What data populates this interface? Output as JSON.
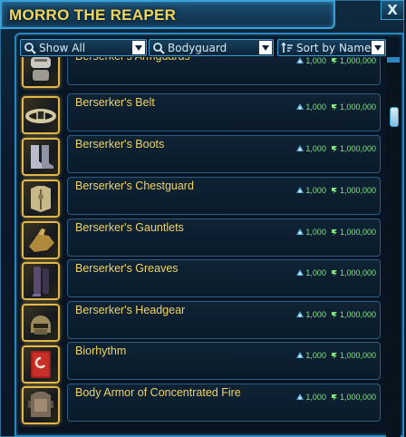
{
  "window": {
    "title": "MORRO THE REAPER",
    "close_label": "X"
  },
  "filters": {
    "category": "Show All",
    "subcategory": "Bodyguard",
    "sort": "Sort by Name"
  },
  "colors": {
    "title": "#f0d65a",
    "item_name": "#f0d462",
    "price": "#7fe37f",
    "accent": "#3aa0d8",
    "icon_border": "#e3b64a"
  },
  "items": [
    {
      "name": "Berserker's Armguards",
      "icon": "armguards-icon",
      "cost_a": "1,000",
      "cost_b": "1,000,000"
    },
    {
      "name": "Berserker's Belt",
      "icon": "belt-icon",
      "cost_a": "1,000",
      "cost_b": "1,000,000"
    },
    {
      "name": "Berserker's Boots",
      "icon": "boots-icon",
      "cost_a": "1,000",
      "cost_b": "1,000,000"
    },
    {
      "name": "Berserker's Chestguard",
      "icon": "chestguard-icon",
      "cost_a": "1,000",
      "cost_b": "1,000,000"
    },
    {
      "name": "Berserker's Gauntlets",
      "icon": "gauntlets-icon",
      "cost_a": "1,000",
      "cost_b": "1,000,000"
    },
    {
      "name": "Berserker's Greaves",
      "icon": "greaves-icon",
      "cost_a": "1,000",
      "cost_b": "1,000,000"
    },
    {
      "name": "Berserker's Headgear",
      "icon": "headgear-icon",
      "cost_a": "1,000",
      "cost_b": "1,000,000"
    },
    {
      "name": "Biorhythm",
      "icon": "biorhythm-book-icon",
      "cost_a": "1,000",
      "cost_b": "1,000,000"
    },
    {
      "name": "Body Armor of Concentrated Fire",
      "icon": "body-armor-icon",
      "cost_a": "1,000",
      "cost_b": "1,000,000"
    }
  ]
}
